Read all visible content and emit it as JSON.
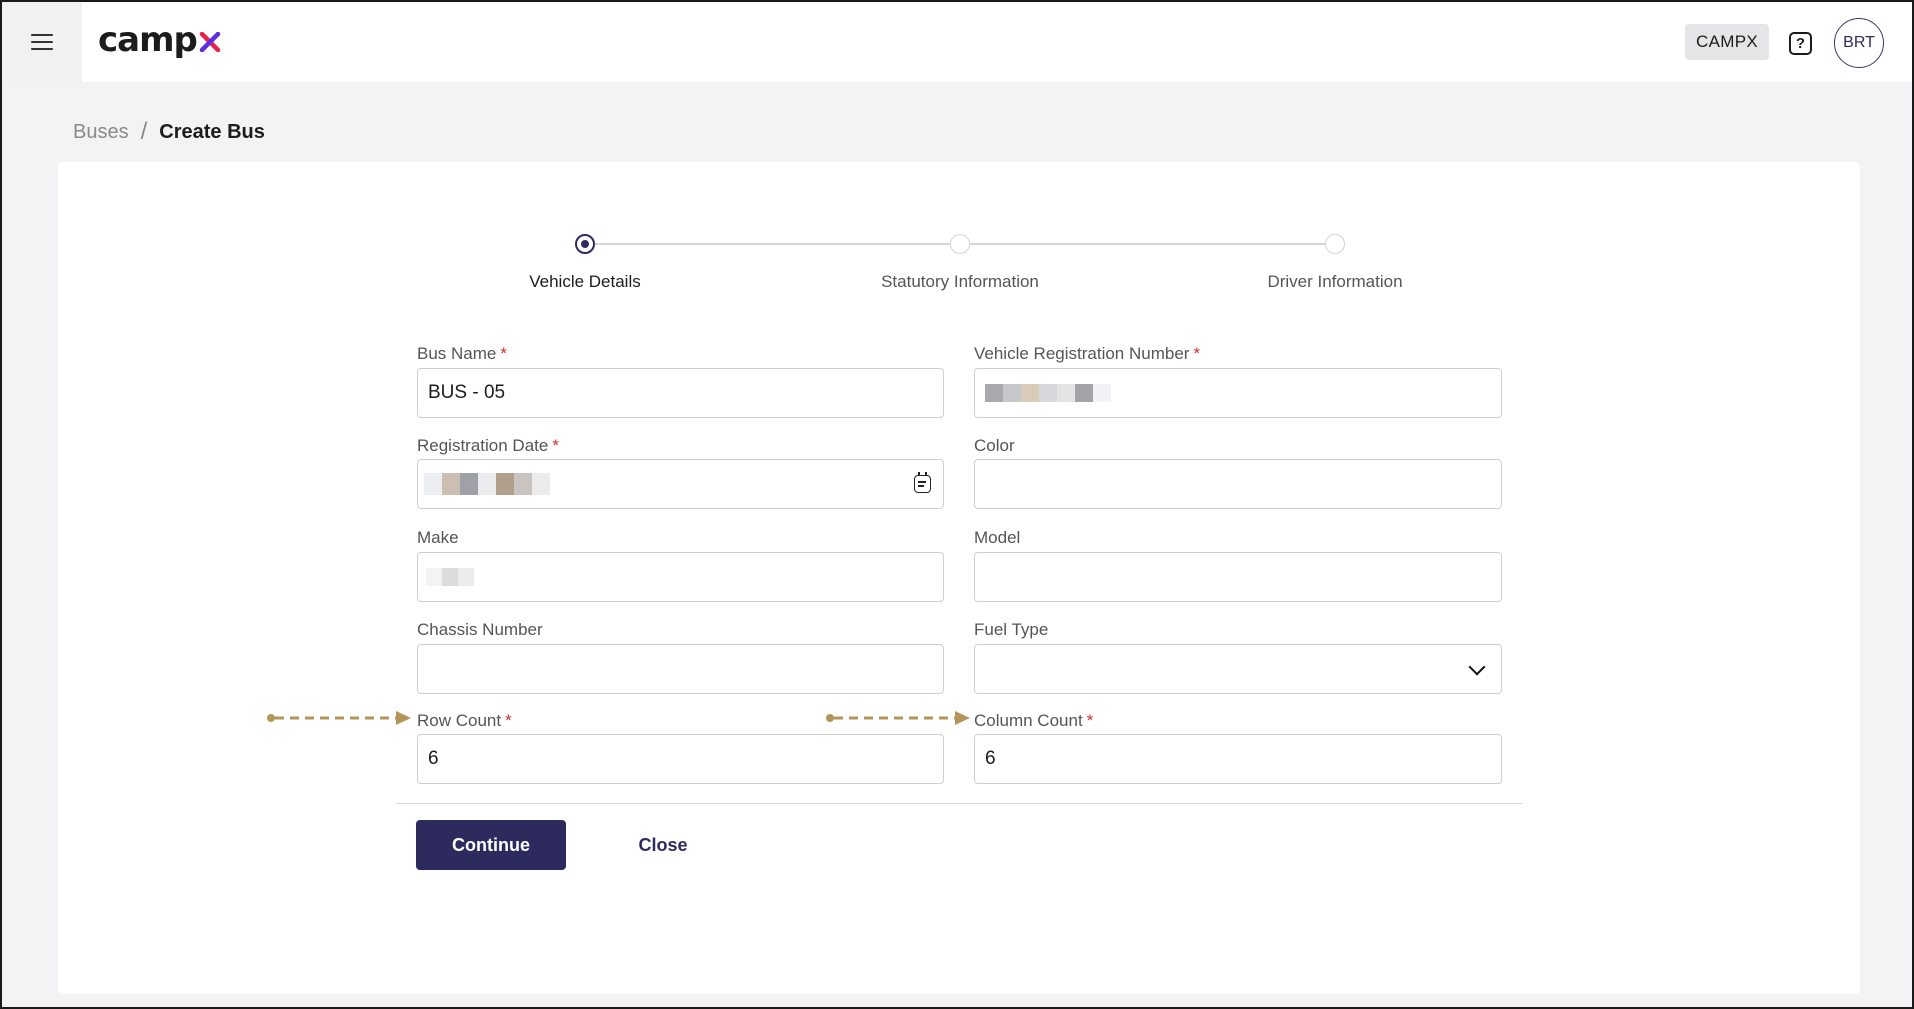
{
  "app": {
    "logo_text": "camp",
    "institution_badge": "CAMPX",
    "help_glyph": "?",
    "user_initials": "BRT",
    "colors": {
      "primary": "#2d2a5e",
      "required": "#d32f2f",
      "logo_x_red": "#e8234a",
      "logo_x_purple": "#5b2ee0",
      "annotation": "#b5945a"
    }
  },
  "icons": {
    "menu": "hamburger-menu-icon",
    "help": "help-icon",
    "calendar": "calendar-icon",
    "dropdown": "chevron-down-icon"
  },
  "breadcrumb": {
    "parent": "Buses",
    "separator": "/",
    "current": "Create Bus"
  },
  "stepper": {
    "steps": [
      {
        "label": "Vehicle Details",
        "active": true
      },
      {
        "label": "Statutory Information",
        "active": false
      },
      {
        "label": "Driver Information",
        "active": false
      }
    ]
  },
  "form": {
    "bus_name": {
      "label": "Bus Name",
      "required_mark": "*",
      "value": "BUS - 05"
    },
    "registration_number": {
      "label": "Vehicle Registration Number",
      "required_mark": "*",
      "value": ""
    },
    "registration_date": {
      "label": "Registration Date",
      "required_mark": "*",
      "value": ""
    },
    "color": {
      "label": "Color",
      "value": ""
    },
    "make": {
      "label": "Make",
      "value": ""
    },
    "model": {
      "label": "Model",
      "value": ""
    },
    "chassis_number": {
      "label": "Chassis Number",
      "value": ""
    },
    "fuel_type": {
      "label": "Fuel Type",
      "value": ""
    },
    "row_count": {
      "label": "Row Count",
      "required_mark": "*",
      "value": "6"
    },
    "column_count": {
      "label": "Column Count",
      "required_mark": "*",
      "value": "6"
    }
  },
  "actions": {
    "continue_label": "Continue",
    "close_label": "Close"
  }
}
